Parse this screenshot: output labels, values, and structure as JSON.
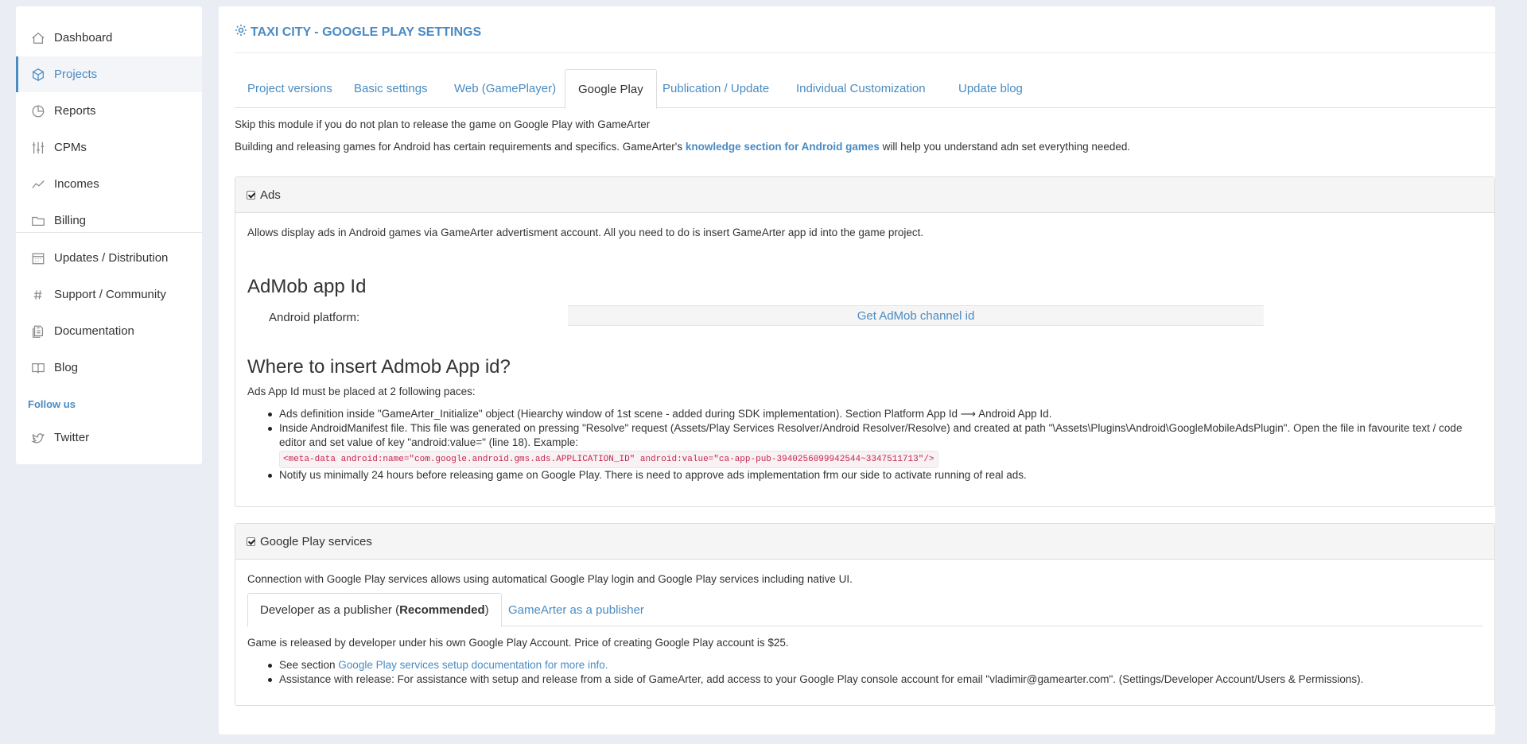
{
  "sidebar": {
    "items": [
      {
        "label": "Dashboard",
        "icon": "home-icon"
      },
      {
        "label": "Projects",
        "icon": "cube-icon",
        "active": true
      },
      {
        "label": "Reports",
        "icon": "pie-icon"
      },
      {
        "label": "CPMs",
        "icon": "sliders-icon"
      },
      {
        "label": "Incomes",
        "icon": "trend-icon"
      },
      {
        "label": "Billing",
        "icon": "folder-icon"
      },
      {
        "label": "Updates / Distribution",
        "icon": "calendar-icon"
      },
      {
        "label": "Support / Community",
        "icon": "hash-icon"
      },
      {
        "label": "Documentation",
        "icon": "docs-icon"
      },
      {
        "label": "Blog",
        "icon": "book-icon"
      }
    ],
    "follow_label": "Follow us",
    "twitter_label": "Twitter"
  },
  "header": {
    "title": "TAXI CITY - GOOGLE PLAY SETTINGS"
  },
  "tabs": [
    {
      "label": "Project versions"
    },
    {
      "label": "Basic settings"
    },
    {
      "label": "Web (GamePlayer)"
    },
    {
      "label": "Google Play",
      "active": true
    },
    {
      "label": "Publication / Update"
    },
    {
      "label": "Individual Customization"
    },
    {
      "label": "Update blog"
    }
  ],
  "intro": {
    "line1": "Skip this module if you do not plan to release the game on Google Play with GameArter",
    "line2_pre": "Building and releasing games for Android has certain requirements and specifics. GameArter's ",
    "line2_link": "knowledge section for Android games",
    "line2_post": " will help you understand adn set everything needed."
  },
  "ads": {
    "title": "Ads",
    "desc": "Allows display ads in Android games via GameArter advertisment account. All you need to do is insert GameArter app id into the game project.",
    "admob_heading": "AdMob app Id",
    "platform_label": "Android platform:",
    "get_id_label": "Get AdMob channel id",
    "where_heading": "Where to insert Admob App id?",
    "placed_text": "Ads App Id must be placed at 2 following paces:",
    "bullet1": "Ads definition inside \"GameArter_Initialize\" object (Hiearchy window of 1st scene - added during SDK implementation). Section Platform App Id ⟶ Android App Id.",
    "bullet2a": "Inside AndroidManifest file. This file was generated on pressing \"Resolve\" request (Assets/Play Services Resolver/Android Resolver/Resolve) and created at path \"\\Assets\\Plugins\\Android\\GoogleMobileAdsPlugin\". Open the file in favourite text / code",
    "bullet2b": "editor and set value of key \"android:value=\" (line 18). Example:",
    "code": "<meta-data android:name=\"com.google.android.gms.ads.APPLICATION_ID\" android:value=\"ca-app-pub-3940256099942544~3347511713\"/>",
    "bullet3": "Notify us minimally 24 hours before releasing game on Google Play. There is need to approve ads implementation frm our side to activate running of real ads."
  },
  "gps": {
    "title": "Google Play services",
    "desc": "Connection with Google Play services allows using automatical Google Play login and Google Play services including native UI.",
    "tab1_pre": "Developer as a publisher (",
    "tab1_bold": "Recommended",
    "tab1_post": ")",
    "tab2": "GameArter as a publisher",
    "released_text": "Game is released by developer under his own Google Play Account. Price of creating Google Play account is $25.",
    "b1_pre": "See section ",
    "b1_link": "Google Play services setup documentation for more info.",
    "b2": "Assistance with release: For assistance with setup and release from a side of GameArter, add access to your Google Play console account for email \"vladimir@gamearter.com\". (Settings/Developer Account/Users & Permissions)."
  }
}
